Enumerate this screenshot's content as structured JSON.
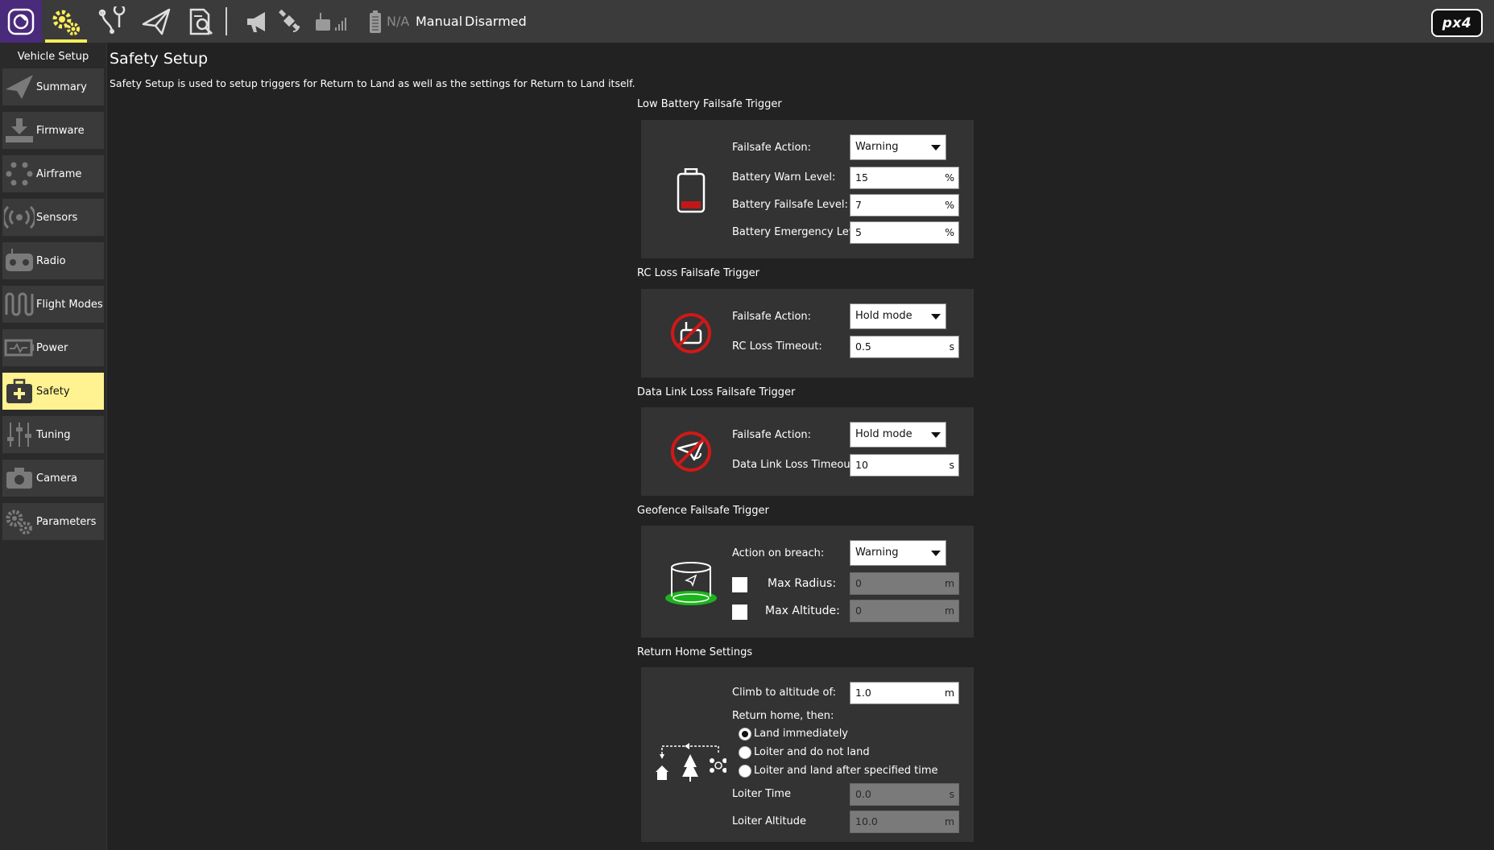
{
  "toolbar": {
    "icons": [
      "qgc-logo-icon",
      "vehicle-setup-icon",
      "plan-icon",
      "fly-icon",
      "analyze-icon",
      "messages-icon",
      "gps-icon",
      "rc-rssi-icon",
      "battery-icon"
    ],
    "battery_text": "N/A",
    "flight_mode": "Manual",
    "arm_status": "Disarmed",
    "brand_logo_text": "px4"
  },
  "sidebar": {
    "title": "Vehicle Setup",
    "items": [
      {
        "label": "Summary",
        "icon": "paper-plane-icon"
      },
      {
        "label": "Firmware",
        "icon": "download-icon"
      },
      {
        "label": "Airframe",
        "icon": "airframe-icon"
      },
      {
        "label": "Sensors",
        "icon": "sensors-icon"
      },
      {
        "label": "Radio",
        "icon": "radio-icon"
      },
      {
        "label": "Flight Modes",
        "icon": "wave-icon"
      },
      {
        "label": "Power",
        "icon": "power-icon"
      },
      {
        "label": "Safety",
        "icon": "safety-case-icon",
        "active": true
      },
      {
        "label": "Tuning",
        "icon": "sliders-icon"
      },
      {
        "label": "Camera",
        "icon": "camera-icon"
      },
      {
        "label": "Parameters",
        "icon": "gears-icon"
      }
    ]
  },
  "main": {
    "title": "Safety Setup",
    "description": "Safety Setup is used to setup triggers for Return to Land as well as the settings for Return to Land itself."
  },
  "low_battery": {
    "title": "Low Battery Failsafe Trigger",
    "failsafe_action_label": "Failsafe Action:",
    "failsafe_action_value": "Warning",
    "warn_label": "Battery Warn Level:",
    "warn_value": "15",
    "failsafe_label": "Battery Failsafe Level:",
    "failsafe_value": "7",
    "emergency_label": "Battery Emergency Level:",
    "emergency_value": "5",
    "unit": "%"
  },
  "rc_loss": {
    "title": "RC Loss Failsafe Trigger",
    "failsafe_action_label": "Failsafe Action:",
    "failsafe_action_value": "Hold mode",
    "timeout_label": "RC Loss Timeout:",
    "timeout_value": "0.5",
    "unit": "s"
  },
  "datalink_loss": {
    "title": "Data Link Loss Failsafe Trigger",
    "failsafe_action_label": "Failsafe Action:",
    "failsafe_action_value": "Hold mode",
    "timeout_label": "Data Link Loss Timeout:",
    "timeout_value": "10",
    "unit": "s"
  },
  "geofence": {
    "title": "Geofence Failsafe Trigger",
    "action_label": "Action on breach:",
    "action_value": "Warning",
    "max_radius_label": "Max Radius:",
    "max_radius_value": "0",
    "max_radius_checked": false,
    "max_altitude_label": "Max Altitude:",
    "max_altitude_value": "0",
    "max_altitude_checked": false,
    "unit": "m"
  },
  "return_home": {
    "title": "Return Home Settings",
    "climb_label": "Climb to altitude of:",
    "climb_value": "1.0",
    "climb_unit": "m",
    "then_label": "Return home, then:",
    "options": [
      {
        "label": "Land immediately",
        "selected": true
      },
      {
        "label": "Loiter and do not land",
        "selected": false
      },
      {
        "label": "Loiter and land after specified time",
        "selected": false
      }
    ],
    "loiter_time_label": "Loiter Time",
    "loiter_time_value": "0.0",
    "loiter_time_unit": "s",
    "loiter_alt_label": "Loiter Altitude",
    "loiter_alt_value": "10.0",
    "loiter_alt_unit": "m"
  },
  "colors": {
    "accent_yellow": "#fff291",
    "toolbar_bg": "#3b3b3b",
    "page_bg": "#222222",
    "panel_bg": "#333333",
    "home_button_bg": "#4a2a7a",
    "geofence_green": "#1db31d",
    "battery_red": "#c01818"
  }
}
